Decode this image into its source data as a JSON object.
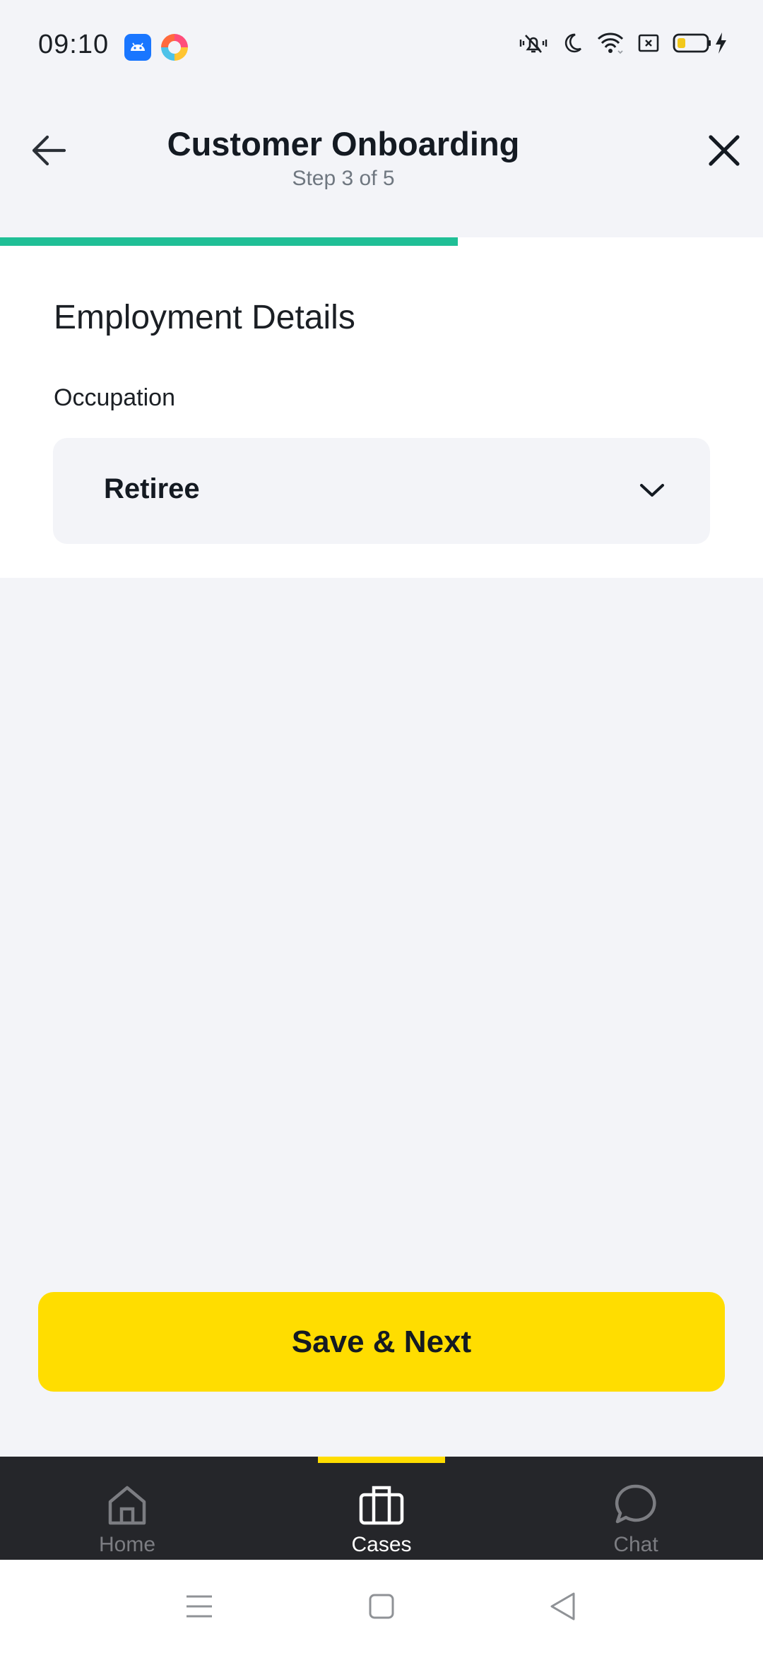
{
  "status_bar": {
    "time": "09:10",
    "app_icons": [
      "android-app-icon",
      "colorful-app-icon"
    ],
    "system_icons": [
      "vibrate-mute-icon",
      "do-not-disturb-moon-icon",
      "wifi-icon",
      "screen-record-icon",
      "battery-icon",
      "charging-bolt-icon"
    ]
  },
  "header": {
    "title": "Customer Onboarding",
    "subtitle": "Step 3 of 5",
    "back_icon": "arrow-left-icon",
    "close_icon": "close-icon"
  },
  "progress": {
    "current_step": 3,
    "total_steps": 5,
    "fraction": 0.6,
    "color": "#1fbf96"
  },
  "form": {
    "section_title": "Employment Details",
    "occupation": {
      "label": "Occupation",
      "value": "Retiree",
      "icon": "chevron-down-icon"
    }
  },
  "actions": {
    "save_next_label": "Save & Next",
    "accent_color": "#ffdd00"
  },
  "bottom_nav": {
    "items": [
      {
        "label": "Home",
        "icon": "home-icon",
        "active": false
      },
      {
        "label": "Cases",
        "icon": "briefcase-icon",
        "active": true
      },
      {
        "label": "Chat",
        "icon": "chat-bubble-icon",
        "active": false
      }
    ]
  },
  "system_nav": {
    "buttons": [
      "menu-icon",
      "home-square-icon",
      "back-triangle-icon"
    ]
  }
}
